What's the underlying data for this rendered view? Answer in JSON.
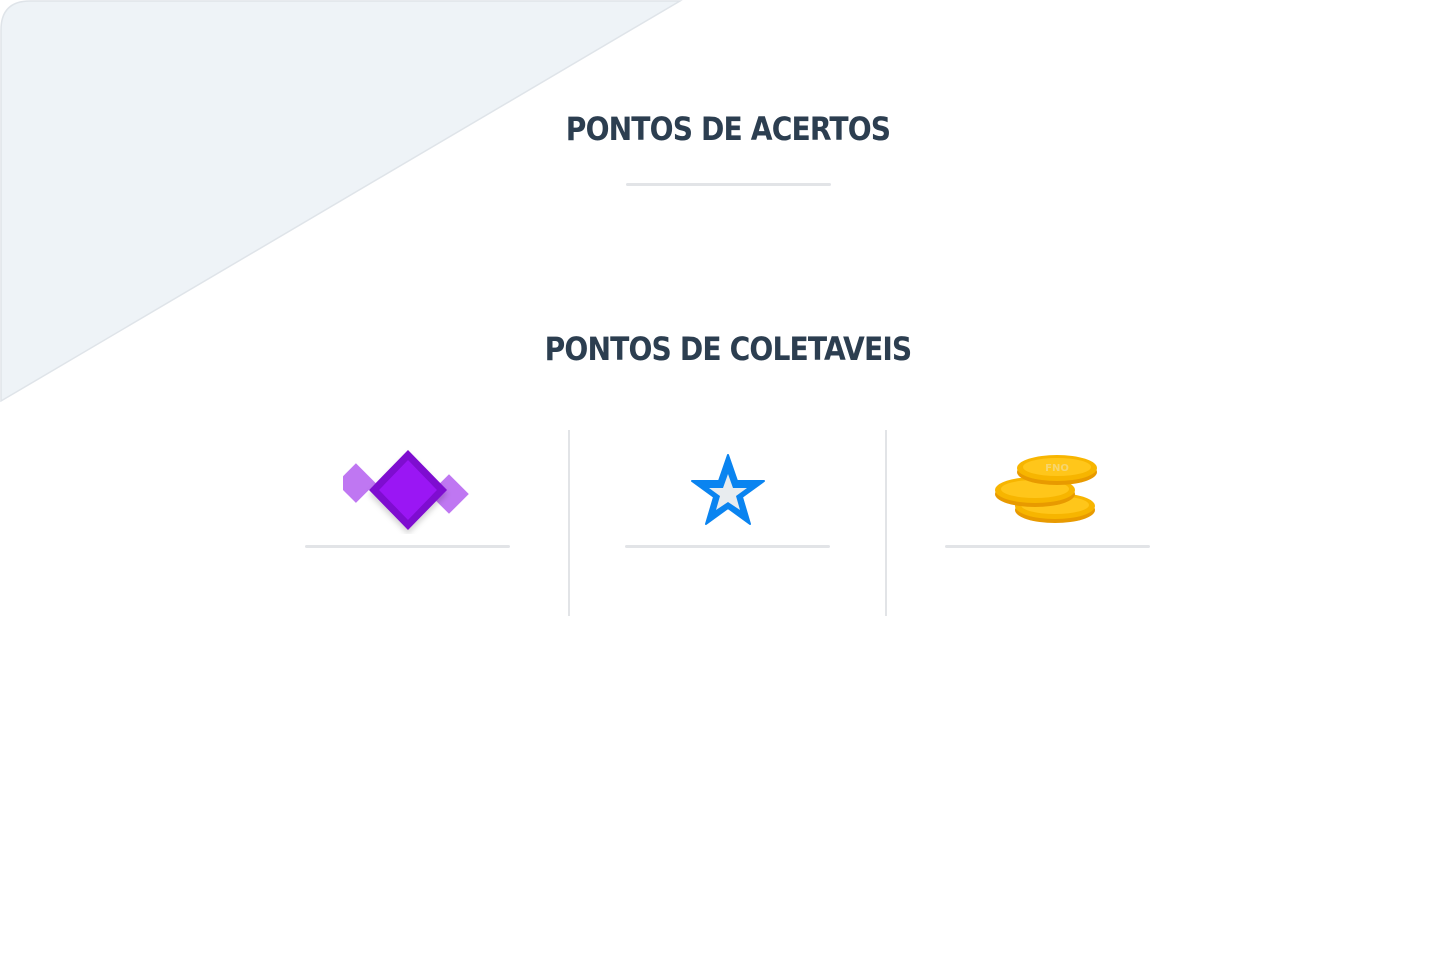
{
  "sections": {
    "acertos": {
      "title": "PONTOS DE ACERTOS",
      "value": ""
    },
    "coletaveis": {
      "title": "PONTOS DE COLETAVEIS",
      "items": [
        {
          "icon": "purple-gem-icon",
          "value": ""
        },
        {
          "icon": "blue-star-icon",
          "value": ""
        },
        {
          "icon": "gold-coins-icon",
          "value": ""
        }
      ]
    }
  },
  "colors": {
    "title": "#2c3e50",
    "background_shape": "#eef3f7",
    "divider": "#e2e4e7",
    "gem": "#8e0ee0",
    "star": "#0a84f0",
    "coin": "#f7b500"
  }
}
